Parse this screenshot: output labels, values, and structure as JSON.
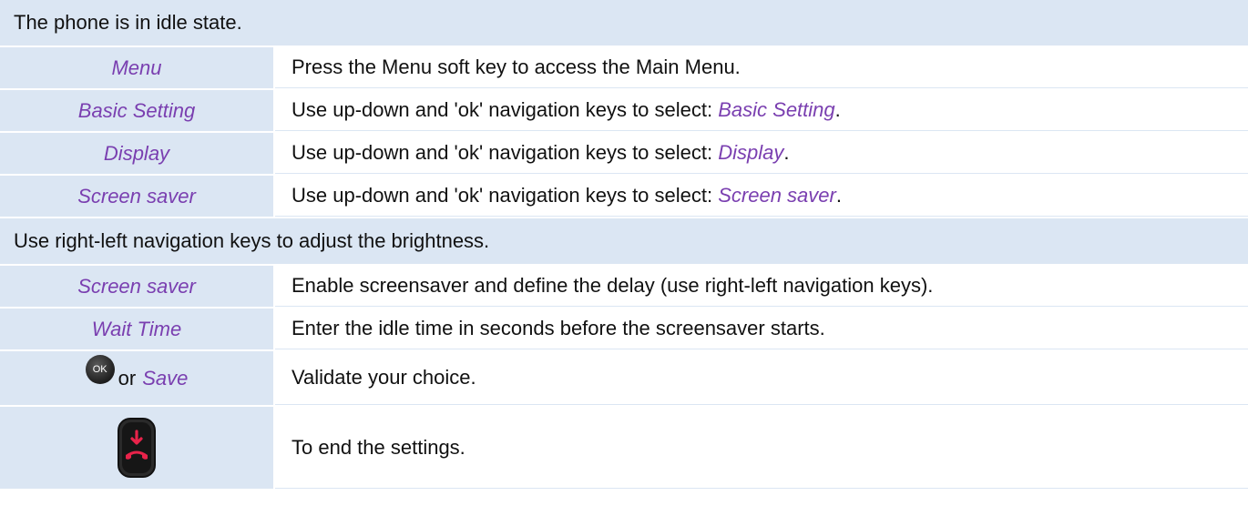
{
  "header_rows": {
    "idle": "The phone is in idle state.",
    "adjust": "Use right-left navigation keys to adjust the brightness."
  },
  "steps": [
    {
      "key": "Menu",
      "desc": "Press the Menu soft key to access the Main Menu."
    },
    {
      "key": "Basic Setting",
      "desc_prefix": "Use up-down and 'ok' navigation keys to select: ",
      "desc_emph": "Basic Setting",
      "desc_suffix": "."
    },
    {
      "key": "Display",
      "desc_prefix": "Use up-down and 'ok' navigation keys to select: ",
      "desc_emph": "Display",
      "desc_suffix": "."
    },
    {
      "key": "Screen saver",
      "desc_prefix": "Use up-down and 'ok' navigation keys to select: ",
      "desc_emph": "Screen saver",
      "desc_suffix": "."
    },
    {
      "key": "Screen saver",
      "desc": "Enable screensaver and define the delay (use right-left navigation keys)."
    },
    {
      "key": "Wait Time",
      "desc": "Enter the idle time in seconds before the screensaver starts."
    },
    {
      "key_icon": "ok-key-icon",
      "key_icon_label": "OK",
      "key_or": "or",
      "key": "Save",
      "desc": "Validate your choice."
    },
    {
      "key_icon": "hang-up-key-icon",
      "desc": "To end the settings."
    }
  ],
  "colors": {
    "accent_purple": "#7a3fb0",
    "row_shade": "#dbe6f3",
    "hangup_red": "#e8234a"
  }
}
